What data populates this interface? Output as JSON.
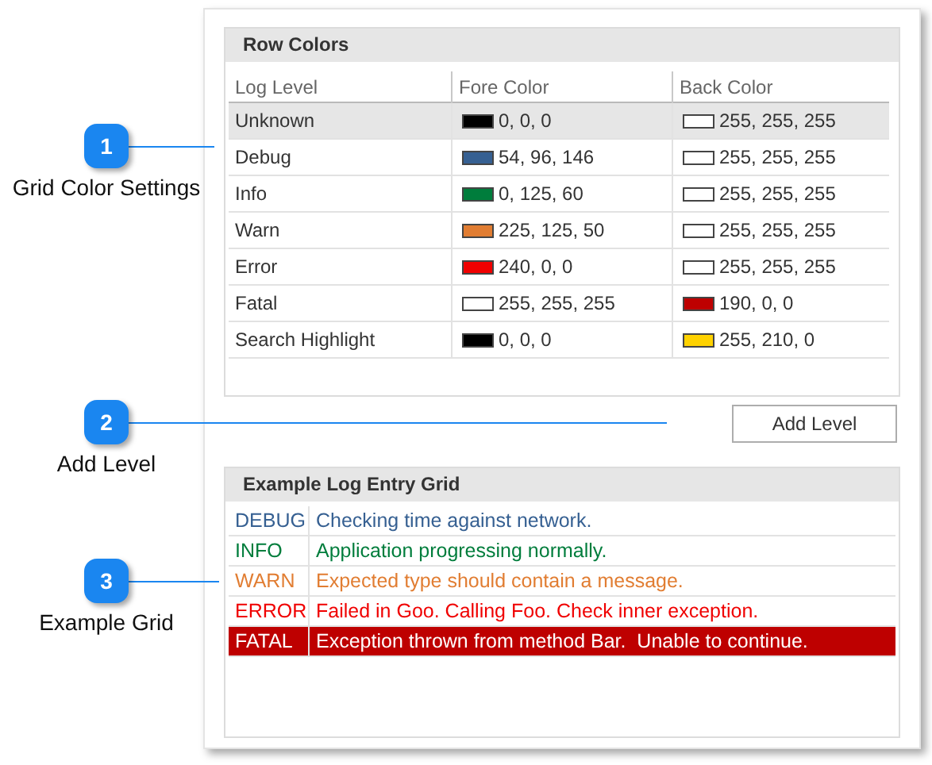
{
  "callouts": [
    {
      "number": "1",
      "label": "Grid Color Settings"
    },
    {
      "number": "2",
      "label": "Add Level"
    },
    {
      "number": "3",
      "label": "Example Grid"
    }
  ],
  "row_colors": {
    "title": "Row Colors",
    "columns": [
      "Log Level",
      "Fore Color",
      "Back Color"
    ],
    "rows": [
      {
        "level": "Unknown",
        "selected": true,
        "fore": {
          "text": "0, 0, 0",
          "color": "#000000"
        },
        "back": {
          "text": "255, 255, 255",
          "color": "#ffffff"
        }
      },
      {
        "level": "Debug",
        "selected": false,
        "fore": {
          "text": "54, 96, 146",
          "color": "#366092"
        },
        "back": {
          "text": "255, 255, 255",
          "color": "#ffffff"
        }
      },
      {
        "level": "Info",
        "selected": false,
        "fore": {
          "text": "0, 125, 60",
          "color": "#007d3c"
        },
        "back": {
          "text": "255, 255, 255",
          "color": "#ffffff"
        }
      },
      {
        "level": "Warn",
        "selected": false,
        "fore": {
          "text": "225, 125, 50",
          "color": "#e17d32"
        },
        "back": {
          "text": "255, 255, 255",
          "color": "#ffffff"
        }
      },
      {
        "level": "Error",
        "selected": false,
        "fore": {
          "text": "240, 0, 0",
          "color": "#f00000"
        },
        "back": {
          "text": "255, 255, 255",
          "color": "#ffffff"
        }
      },
      {
        "level": "Fatal",
        "selected": false,
        "fore": {
          "text": "255, 255, 255",
          "color": "#ffffff"
        },
        "back": {
          "text": "190, 0, 0",
          "color": "#be0000"
        }
      },
      {
        "level": "Search Highlight",
        "selected": false,
        "fore": {
          "text": "0, 0, 0",
          "color": "#000000"
        },
        "back": {
          "text": "255, 210, 0",
          "color": "#ffd200"
        }
      }
    ]
  },
  "add_button": "Add Level",
  "example_grid": {
    "title": "Example Log Entry Grid",
    "rows": [
      {
        "level": "DEBUG",
        "message": "Checking time against network.",
        "color": "#366092",
        "highlighted": false
      },
      {
        "level": "INFO",
        "message": "Application progressing normally.",
        "color": "#007d3c",
        "highlighted": false
      },
      {
        "level": "WARN",
        "message": "Expected type should contain a message.",
        "color": "#e17d32",
        "highlighted": false
      },
      {
        "level": "ERROR",
        "message": "Failed in Goo. Calling Foo. Check inner exception.",
        "color": "#f00000",
        "highlighted": false
      },
      {
        "level": "FATAL",
        "message": "Exception thrown from method Bar.  Unable to continue.",
        "color": "#ffffff",
        "highlighted": true
      }
    ]
  }
}
